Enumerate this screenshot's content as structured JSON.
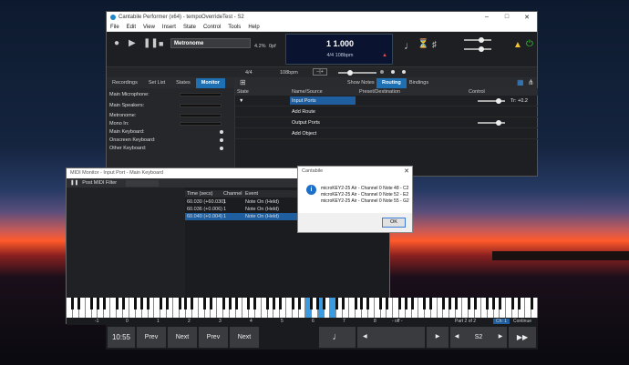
{
  "main_window": {
    "title": "Cantabile Performer (x64) - tempoOverrideTest - S2",
    "controls": [
      "–",
      "□",
      "✕"
    ],
    "menu": [
      "File",
      "Edit",
      "View",
      "Insert",
      "State",
      "Control",
      "Tools",
      "Help"
    ],
    "song_name": "Metronome",
    "load": "4.2%",
    "offset": "0pf",
    "position": "1 1.000",
    "time_info": "4/4 108bpm",
    "time_signature": "4/4",
    "tempo": "108bpm",
    "tabs_left": [
      "Recordings",
      "Set List",
      "States",
      "Monitor"
    ],
    "active_left_tab": "Monitor",
    "tabs_right": [
      "Show Notes",
      "Routing",
      "Bindings"
    ],
    "active_right_tab": "Routing",
    "monitor_rows": [
      "Main Microphone:",
      "Main Speakers:",
      "Metronome:",
      "Mono In:",
      "Main Keyboard:",
      "Onscreen Keyboard:",
      "Other Keyboard:"
    ],
    "routing_headers": [
      "State",
      "Name/Source",
      "Preset/Destination",
      "Control"
    ],
    "routing_rows": [
      "Input Ports",
      "Add Route",
      "Output Ports",
      "Add Object"
    ],
    "transpose_label": "Tr: +0.2"
  },
  "midi_monitor": {
    "title": "MIDI Monitor - Input Port - Main Keyboard",
    "filter_label": "Post MIDI Filter",
    "headers": [
      "Time (secs)",
      "Channel",
      "Event"
    ],
    "rows": [
      {
        "time": "60.030 (+60.030)",
        "channel": "1",
        "event": "Note On (Held)"
      },
      {
        "time": "60.036 (+0.006)",
        "channel": "1",
        "event": "Note On (Held)"
      },
      {
        "time": "60.040 (+0.004)",
        "channel": "1",
        "event": "Note On (Held)"
      }
    ]
  },
  "keyboard": {
    "octaves": [
      "-1",
      "0",
      "1",
      "2",
      "3",
      "4",
      "5",
      "6",
      "7",
      "8"
    ],
    "status_off": "- off -",
    "part": "Part 2 of 2",
    "channel": "Ch: 1",
    "continue": "Continue"
  },
  "bottom_bar": {
    "clock": "10:55",
    "prev1": "Prev",
    "next1": "Next",
    "prev2": "Prev",
    "next2": "Next",
    "song": "S2"
  },
  "dialog": {
    "title": "Cantabile",
    "lines": [
      "microKEY2-25 Air - Channel 0 Note 48 - C2",
      "microKEY2-25 Air - Channel 0 Note 52 - E2",
      "microKEY2-25 Air - Channel 0 Note 55 - G2"
    ],
    "ok": "OK"
  }
}
